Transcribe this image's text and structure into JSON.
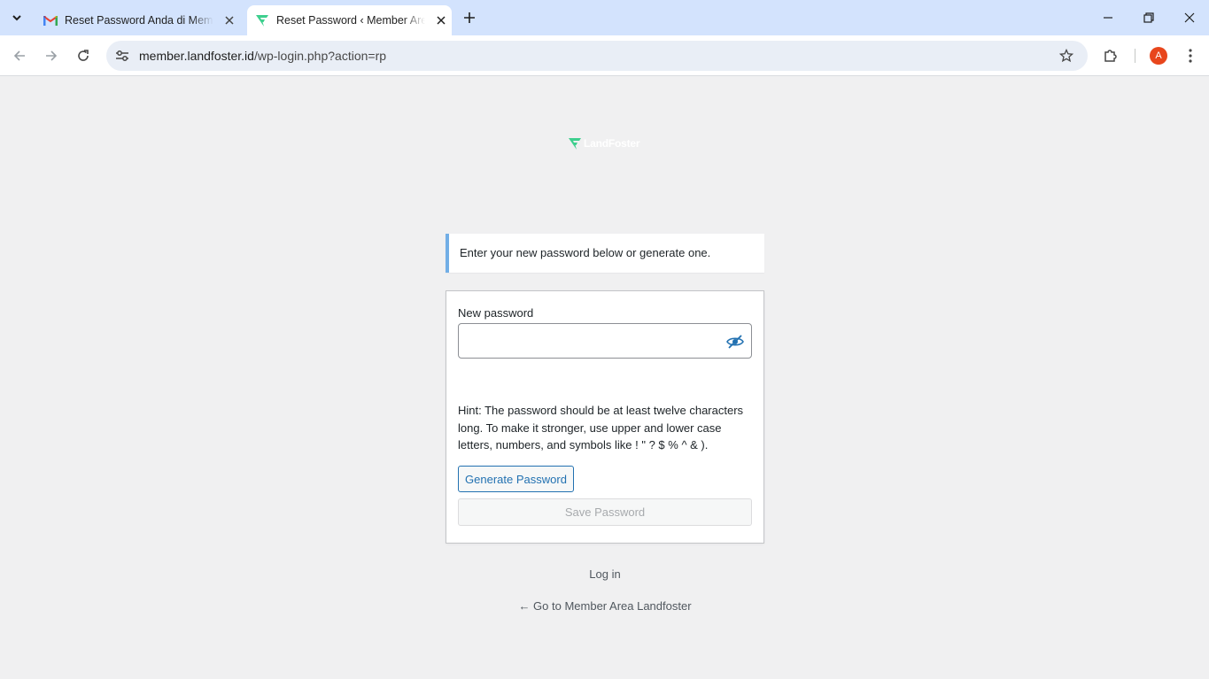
{
  "browser": {
    "tabs": [
      {
        "title": "Reset Password Anda di Member Area Landfoster",
        "favicon": "gmail-icon",
        "active": false
      },
      {
        "title": "Reset Password ‹ Member Area Landfoster",
        "favicon": "landfoster-icon",
        "active": true
      }
    ],
    "url_host": "member.landfoster.id",
    "url_path": "/wp-login.php?action=rp",
    "profile_initial": "A",
    "accent": "#d3e3fd"
  },
  "page": {
    "logo_text": "LandFoster",
    "message": "Enter your new password below or generate one.",
    "password_label": "New password",
    "password_value": "",
    "hint": "Hint: The password should be at least twelve characters long. To make it stronger, use upper and lower case letters, numbers, and symbols like ! \" ? $ % ^ & ).",
    "generate_label": "Generate Password",
    "save_label": "Save Password",
    "login_link": "Log in",
    "back_link": "← Go to Member Area Landfoster",
    "colors": {
      "background": "#f0f0f1",
      "primary": "#2271b1",
      "message_border": "#72aee6",
      "logo_green": "#3ecf8e"
    }
  }
}
